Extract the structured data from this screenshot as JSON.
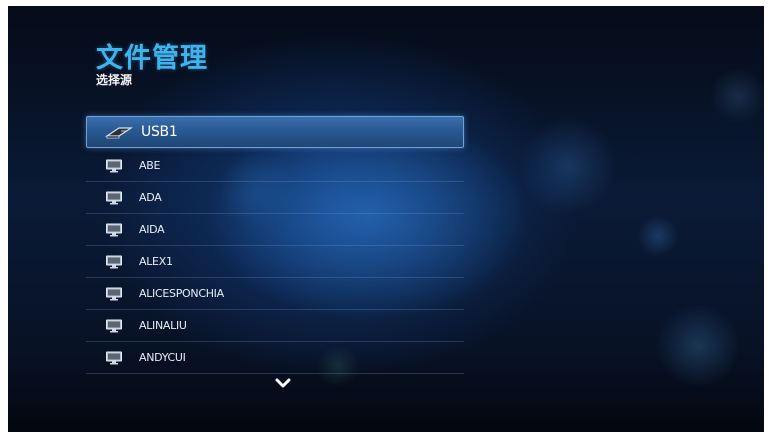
{
  "header": {
    "title": "文件管理",
    "subtitle": "选择源"
  },
  "colors": {
    "accent": "#3fb3ee",
    "selection": "#2d5f9c"
  },
  "list": {
    "selected": {
      "label": "USB1",
      "icon": "usb-drive-icon"
    },
    "items": [
      {
        "label": "ABE",
        "icon": "computer-monitor-icon"
      },
      {
        "label": "ADA",
        "icon": "computer-monitor-icon"
      },
      {
        "label": "AIDA",
        "icon": "computer-monitor-icon"
      },
      {
        "label": "ALEX1",
        "icon": "computer-monitor-icon"
      },
      {
        "label": "ALICESPONCHIA",
        "icon": "computer-monitor-icon"
      },
      {
        "label": "ALINALIU",
        "icon": "computer-monitor-icon"
      },
      {
        "label": "ANDYCUI",
        "icon": "computer-monitor-icon"
      }
    ]
  },
  "navigation": {
    "more_indicator_icon": "chevron-down-icon"
  }
}
